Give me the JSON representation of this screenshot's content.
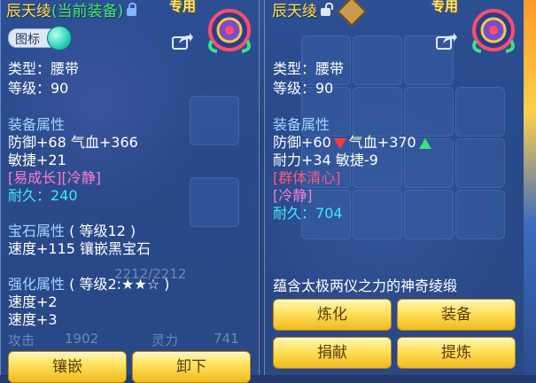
{
  "left": {
    "item_name": "辰天绫",
    "equip_status": "(当前装备)",
    "exclusive_label": "专用",
    "icon_toggle_label": "图标",
    "type_line": "类型：腰带",
    "level_line": "等级：90",
    "attr_header": "装备属性",
    "attr_line1": "防御+68 气血+366",
    "attr_line2": "敏捷+21",
    "special_tags": "[易成长][冷静]",
    "durability_label": "耐久：",
    "durability_value": "240",
    "gem_header": "宝石属性",
    "gem_level": "( 等级12 )",
    "gem_line": "速度+115 镶嵌黑宝石",
    "enhance_header": "强化属性",
    "enhance_level": "( 等级2:★★☆ )",
    "enhance_line1": "速度+2",
    "enhance_line2": "速度+3",
    "buttons": {
      "inlay": "镶嵌",
      "unequip": "卸下"
    },
    "background_text": {
      "attack_label": "攻击",
      "attack_value": "1902",
      "spirit_label": "灵力",
      "spirit_value": "741",
      "hp_bar": "2212/2212"
    }
  },
  "right": {
    "item_name": "辰天绫",
    "exclusive_label": "专用",
    "type_line": "类型：腰带",
    "level_line": "等级：90",
    "attr_header": "装备属性",
    "attr_defense": "防御+60",
    "attr_hp": "气血+370",
    "attr_line2": "耐力+34 敏捷-9",
    "special_tag1": "[群体清心]",
    "special_tag2": "[冷静]",
    "durability_label": "耐久：",
    "durability_value": "704",
    "description": "蕴含太极两仪之力的神奇绫缎",
    "buttons": {
      "refine": "炼化",
      "equip": "装备",
      "donate": "捐献",
      "extract": "提炼"
    }
  },
  "colors": {
    "title": "#ffe14a",
    "section": "#9fd6ff",
    "special": "#ff7bd5",
    "durability": "#3fe7ff",
    "button": "#ffe15a"
  }
}
